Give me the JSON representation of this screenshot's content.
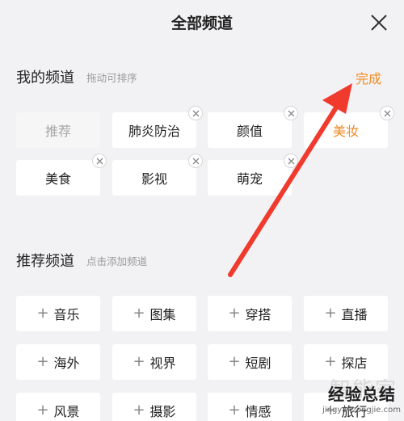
{
  "header": {
    "title": "全部频道",
    "close_icon": "close-icon"
  },
  "my_channels": {
    "title": "我的频道",
    "hint": "拖动可排序",
    "done_label": "完成",
    "items": [
      {
        "label": "推荐"
      },
      {
        "label": "肺炎防治"
      },
      {
        "label": "颜值"
      },
      {
        "label": "美妆"
      },
      {
        "label": "美食"
      },
      {
        "label": "影视"
      },
      {
        "label": "萌宠"
      }
    ]
  },
  "recommended": {
    "title": "推荐频道",
    "hint": "点击添加频道",
    "items": [
      {
        "label": "音乐"
      },
      {
        "label": "图集"
      },
      {
        "label": "穿搭"
      },
      {
        "label": "直播"
      },
      {
        "label": "海外"
      },
      {
        "label": "视界"
      },
      {
        "label": "短剧"
      },
      {
        "label": "探店"
      },
      {
        "label": "风景"
      },
      {
        "label": "摄影"
      },
      {
        "label": "情感"
      },
      {
        "label": "旅行"
      }
    ]
  },
  "plus_sign": "+",
  "watermark": {
    "faint": "智能家",
    "main": "经验总结",
    "url": "jingyanzongjie.com"
  },
  "colors": {
    "accent": "#f08a24",
    "arrow": "#f03a2e",
    "background": "#f2f2f4"
  }
}
